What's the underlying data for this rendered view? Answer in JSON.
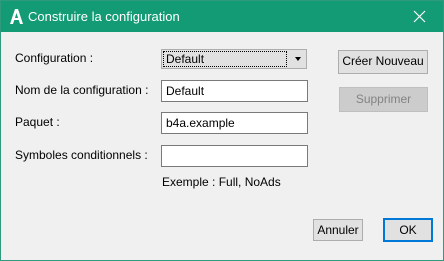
{
  "window": {
    "title": "Construire la configuration",
    "app_icon": "b4a-logo-icon",
    "close_icon": "close-icon",
    "accent_color": "#129b74"
  },
  "form": {
    "configuration_label": "Configuration :",
    "configuration_value": "Default",
    "config_name_label": "Nom de la configuration :",
    "config_name_value": "Default",
    "package_label": "Paquet :",
    "package_value": "b4a.example",
    "symbols_label": "Symboles conditionnels :",
    "symbols_value": "",
    "example_text": "Exemple : Full, NoAds"
  },
  "buttons": {
    "create_new": "Créer Nouveau",
    "delete": "Supprimer",
    "cancel": "Annuler",
    "ok": "OK"
  }
}
